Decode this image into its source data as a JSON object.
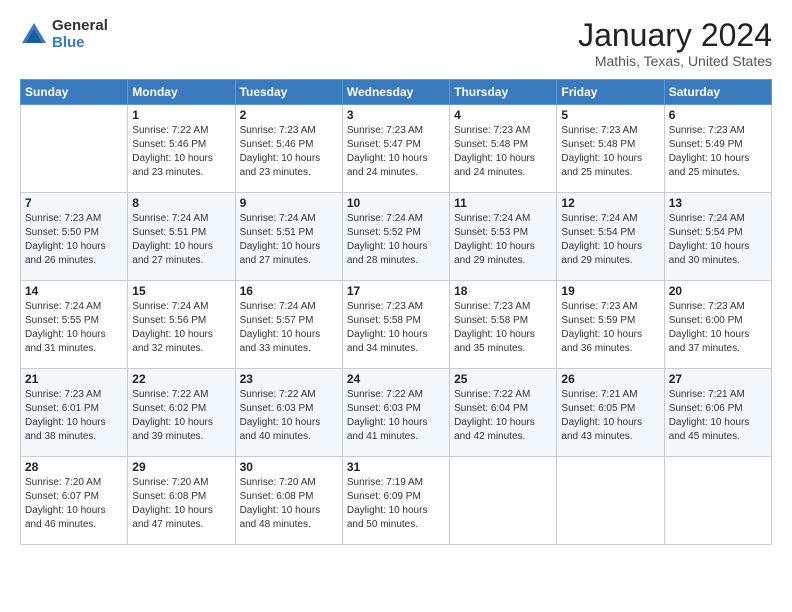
{
  "logo": {
    "general": "General",
    "blue": "Blue"
  },
  "title": "January 2024",
  "location": "Mathis, Texas, United States",
  "days_of_week": [
    "Sunday",
    "Monday",
    "Tuesday",
    "Wednesday",
    "Thursday",
    "Friday",
    "Saturday"
  ],
  "weeks": [
    [
      {
        "day": "",
        "content": ""
      },
      {
        "day": "1",
        "content": "Sunrise: 7:22 AM\nSunset: 5:46 PM\nDaylight: 10 hours\nand 23 minutes."
      },
      {
        "day": "2",
        "content": "Sunrise: 7:23 AM\nSunset: 5:46 PM\nDaylight: 10 hours\nand 23 minutes."
      },
      {
        "day": "3",
        "content": "Sunrise: 7:23 AM\nSunset: 5:47 PM\nDaylight: 10 hours\nand 24 minutes."
      },
      {
        "day": "4",
        "content": "Sunrise: 7:23 AM\nSunset: 5:48 PM\nDaylight: 10 hours\nand 24 minutes."
      },
      {
        "day": "5",
        "content": "Sunrise: 7:23 AM\nSunset: 5:48 PM\nDaylight: 10 hours\nand 25 minutes."
      },
      {
        "day": "6",
        "content": "Sunrise: 7:23 AM\nSunset: 5:49 PM\nDaylight: 10 hours\nand 25 minutes."
      }
    ],
    [
      {
        "day": "7",
        "content": "Sunrise: 7:23 AM\nSunset: 5:50 PM\nDaylight: 10 hours\nand 26 minutes."
      },
      {
        "day": "8",
        "content": "Sunrise: 7:24 AM\nSunset: 5:51 PM\nDaylight: 10 hours\nand 27 minutes."
      },
      {
        "day": "9",
        "content": "Sunrise: 7:24 AM\nSunset: 5:51 PM\nDaylight: 10 hours\nand 27 minutes."
      },
      {
        "day": "10",
        "content": "Sunrise: 7:24 AM\nSunset: 5:52 PM\nDaylight: 10 hours\nand 28 minutes."
      },
      {
        "day": "11",
        "content": "Sunrise: 7:24 AM\nSunset: 5:53 PM\nDaylight: 10 hours\nand 29 minutes."
      },
      {
        "day": "12",
        "content": "Sunrise: 7:24 AM\nSunset: 5:54 PM\nDaylight: 10 hours\nand 29 minutes."
      },
      {
        "day": "13",
        "content": "Sunrise: 7:24 AM\nSunset: 5:54 PM\nDaylight: 10 hours\nand 30 minutes."
      }
    ],
    [
      {
        "day": "14",
        "content": "Sunrise: 7:24 AM\nSunset: 5:55 PM\nDaylight: 10 hours\nand 31 minutes."
      },
      {
        "day": "15",
        "content": "Sunrise: 7:24 AM\nSunset: 5:56 PM\nDaylight: 10 hours\nand 32 minutes."
      },
      {
        "day": "16",
        "content": "Sunrise: 7:24 AM\nSunset: 5:57 PM\nDaylight: 10 hours\nand 33 minutes."
      },
      {
        "day": "17",
        "content": "Sunrise: 7:23 AM\nSunset: 5:58 PM\nDaylight: 10 hours\nand 34 minutes."
      },
      {
        "day": "18",
        "content": "Sunrise: 7:23 AM\nSunset: 5:58 PM\nDaylight: 10 hours\nand 35 minutes."
      },
      {
        "day": "19",
        "content": "Sunrise: 7:23 AM\nSunset: 5:59 PM\nDaylight: 10 hours\nand 36 minutes."
      },
      {
        "day": "20",
        "content": "Sunrise: 7:23 AM\nSunset: 6:00 PM\nDaylight: 10 hours\nand 37 minutes."
      }
    ],
    [
      {
        "day": "21",
        "content": "Sunrise: 7:23 AM\nSunset: 6:01 PM\nDaylight: 10 hours\nand 38 minutes."
      },
      {
        "day": "22",
        "content": "Sunrise: 7:22 AM\nSunset: 6:02 PM\nDaylight: 10 hours\nand 39 minutes."
      },
      {
        "day": "23",
        "content": "Sunrise: 7:22 AM\nSunset: 6:03 PM\nDaylight: 10 hours\nand 40 minutes."
      },
      {
        "day": "24",
        "content": "Sunrise: 7:22 AM\nSunset: 6:03 PM\nDaylight: 10 hours\nand 41 minutes."
      },
      {
        "day": "25",
        "content": "Sunrise: 7:22 AM\nSunset: 6:04 PM\nDaylight: 10 hours\nand 42 minutes."
      },
      {
        "day": "26",
        "content": "Sunrise: 7:21 AM\nSunset: 6:05 PM\nDaylight: 10 hours\nand 43 minutes."
      },
      {
        "day": "27",
        "content": "Sunrise: 7:21 AM\nSunset: 6:06 PM\nDaylight: 10 hours\nand 45 minutes."
      }
    ],
    [
      {
        "day": "28",
        "content": "Sunrise: 7:20 AM\nSunset: 6:07 PM\nDaylight: 10 hours\nand 46 minutes."
      },
      {
        "day": "29",
        "content": "Sunrise: 7:20 AM\nSunset: 6:08 PM\nDaylight: 10 hours\nand 47 minutes."
      },
      {
        "day": "30",
        "content": "Sunrise: 7:20 AM\nSunset: 6:08 PM\nDaylight: 10 hours\nand 48 minutes."
      },
      {
        "day": "31",
        "content": "Sunrise: 7:19 AM\nSunset: 6:09 PM\nDaylight: 10 hours\nand 50 minutes."
      },
      {
        "day": "",
        "content": ""
      },
      {
        "day": "",
        "content": ""
      },
      {
        "day": "",
        "content": ""
      }
    ]
  ]
}
